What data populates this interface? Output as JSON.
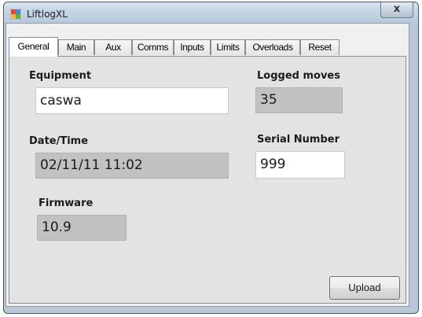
{
  "window": {
    "title": "LiftlogXL",
    "close_glyph": "x"
  },
  "icons": {
    "app": "app-grid-icon",
    "close": "close-icon"
  },
  "tabs": [
    {
      "label": "General",
      "active": true
    },
    {
      "label": "Main",
      "active": false
    },
    {
      "label": "Aux",
      "active": false
    },
    {
      "label": "Comms",
      "active": false
    },
    {
      "label": "Inputs",
      "active": false
    },
    {
      "label": "Limits",
      "active": false
    },
    {
      "label": "Overloads",
      "active": false
    },
    {
      "label": "Reset",
      "active": false
    }
  ],
  "general": {
    "equipment": {
      "label": "Equipment",
      "value": "caswa"
    },
    "logged_moves": {
      "label": "Logged moves",
      "value": "35"
    },
    "date_time": {
      "label": "Date/Time",
      "value": "02/11/11 11:02"
    },
    "serial_number": {
      "label": "Serial Number",
      "value": "999"
    },
    "firmware": {
      "label": "Firmware",
      "value": "10.9"
    }
  },
  "buttons": {
    "upload": "Upload"
  },
  "colors": {
    "frame": "#b9c7d6",
    "panel": "#e3e3e3",
    "readonly_field": "#c2c2c2",
    "editable_field": "#ffffff"
  }
}
